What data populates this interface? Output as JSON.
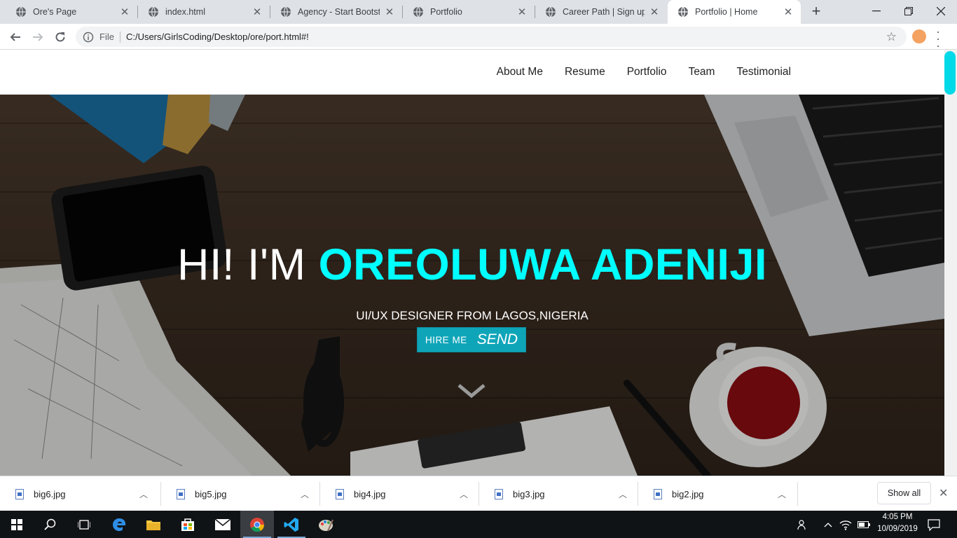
{
  "browser": {
    "tabs": [
      {
        "title": "Ore's Page",
        "active": false
      },
      {
        "title": "index.html",
        "active": false
      },
      {
        "title": "Agency - Start Bootstrap",
        "active": false
      },
      {
        "title": "Portfolio",
        "active": false
      },
      {
        "title": "Career Path | Sign up",
        "active": false
      },
      {
        "title": "Portfolio | Home",
        "active": true
      }
    ],
    "address_scheme": "File",
    "address_url": "C:/Users/GirlsCoding/Desktop/ore/port.html#!"
  },
  "site": {
    "nav": [
      "About Me",
      "Resume",
      "Portfolio",
      "Team",
      "Testimonial"
    ],
    "hero": {
      "greeting": "HI! I'M",
      "name": "OREOLUWA ADENIJI",
      "subtitle": "UI/UX DESIGNER FROM LAGOS,NIGERIA",
      "hire_label": "HIRE ME",
      "send_label": "SEND"
    },
    "accent_color": "#00ffff",
    "button_color": "#0fa5b9"
  },
  "downloads": {
    "items": [
      "big6.jpg",
      "big5.jpg",
      "big4.jpg",
      "big3.jpg",
      "big2.jpg"
    ],
    "show_all": "Show all"
  },
  "taskbar": {
    "time": "4:05 PM",
    "date": "10/09/2019"
  }
}
